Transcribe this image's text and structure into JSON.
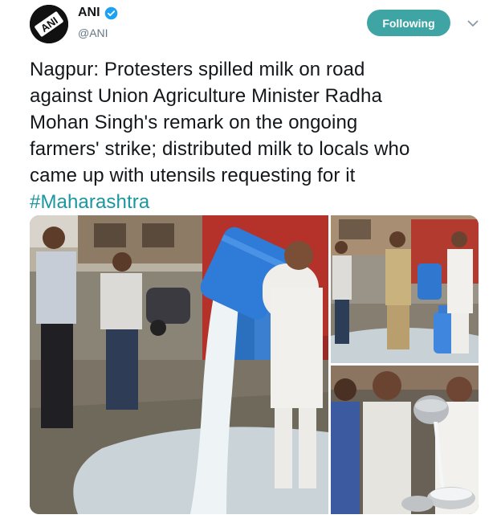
{
  "author": {
    "display_name": "ANI",
    "handle": "@ANI",
    "avatar_text": "ANI",
    "verified": true
  },
  "follow_button": {
    "label": "Following"
  },
  "menu": {
    "icon": "chevron-down-icon"
  },
  "tweet": {
    "lines": [
      "Nagpur: Protesters spilled milk on road",
      "against Union Agriculture Minister Radha",
      "Mohan Singh's remark on the ongoing",
      "farmers' strike; distributed milk to locals who",
      "came up with utensils requesting for it"
    ],
    "hashtag": "#Maharashtra"
  },
  "media": {
    "photos": [
      {
        "name": "milk-spill-photo"
      },
      {
        "name": "milk-can-photo"
      },
      {
        "name": "milk-distribution-photo"
      }
    ]
  },
  "colors": {
    "follow_bg": "#3fa4a4",
    "hashtag": "#1b95a0",
    "verified": "#1da1f2",
    "handle": "#657786"
  }
}
